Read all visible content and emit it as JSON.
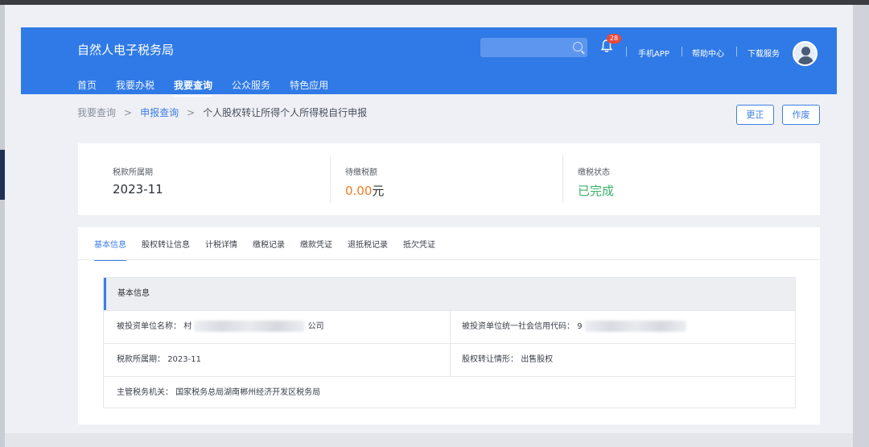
{
  "header": {
    "brand": "自然人电子税务局",
    "notification_count": "28",
    "links": [
      "手机APP",
      "帮助中心",
      "下载服务"
    ]
  },
  "nav": {
    "items": [
      "首页",
      "我要办税",
      "我要查询",
      "公众服务",
      "特色应用"
    ],
    "active": "我要查询"
  },
  "breadcrumb": {
    "root": "我要查询",
    "parent": "申报查询",
    "current": "个人股权转让所得个人所得税自行申报",
    "separator": ">"
  },
  "actions": {
    "correct": "更正",
    "void": "作废"
  },
  "summary": {
    "period_label": "税款所属期",
    "period_value": "2023-11",
    "amount_label": "待缴税额",
    "amount_value": "0.00",
    "amount_unit": "元",
    "status_label": "缴税状态",
    "status_value": "已完成"
  },
  "tabs": [
    "基本信息",
    "股权转让信息",
    "计税详情",
    "缴税记录",
    "缴款凭证",
    "退抵税记录",
    "抵欠凭证"
  ],
  "basic_info": {
    "title": "基本信息",
    "invested_company_label": "被投资单位名称：",
    "invested_company_prefix": "村",
    "invested_company_suffix": "公司",
    "credit_code_label": "被投资单位统一社会信用代码：",
    "credit_code_prefix": "9",
    "period_label": "税款所属期：",
    "period_value": "2023-11",
    "transfer_type_label": "股权转让情形：",
    "transfer_type_value": "出售股权",
    "tax_authority_label": "主管税务机关：",
    "tax_authority_value": "国家税务总局湖南郴州经济开发区税务局"
  },
  "icons": {
    "search": "search-icon",
    "bell": "bell-icon",
    "avatar": "user-avatar-icon"
  },
  "colors": {
    "header_bg": "#2f7ae6",
    "accent": "#3c7ee6",
    "amount": "#ee7d21",
    "status_done": "#37b36a"
  }
}
